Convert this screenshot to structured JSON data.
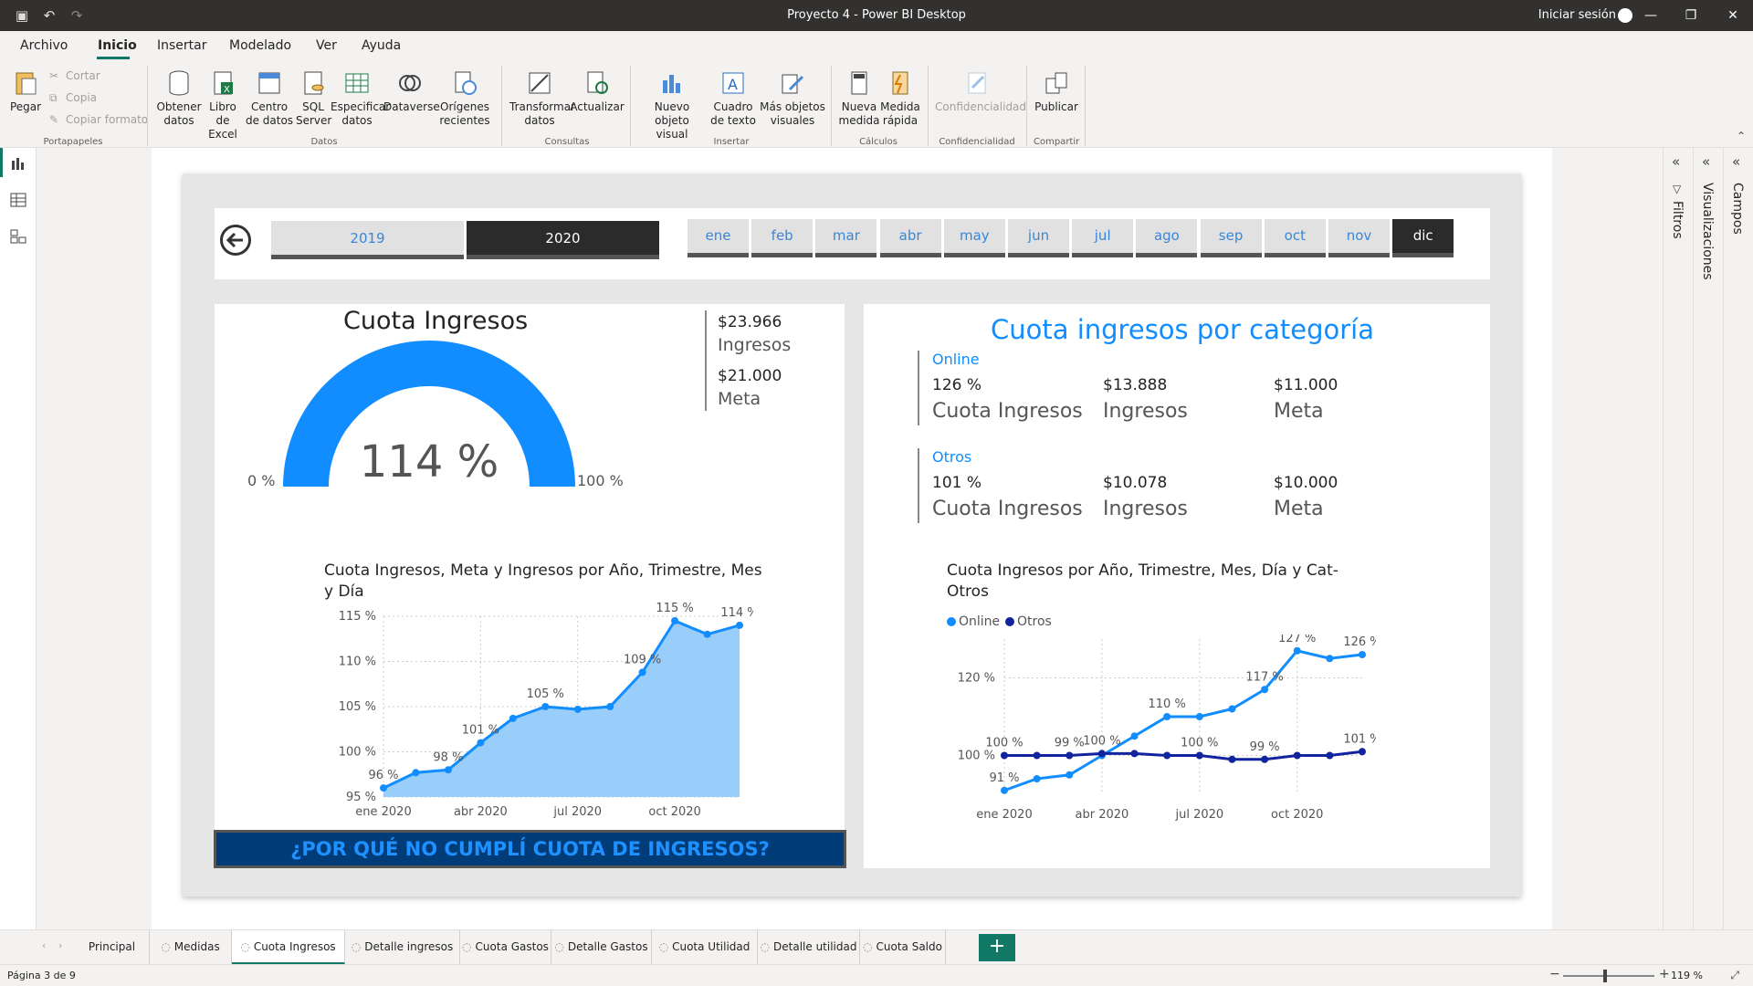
{
  "window": {
    "title": "Proyecto 4 - Power BI Desktop",
    "signin": "Iniciar sesión"
  },
  "menu": {
    "items": [
      "Archivo",
      "Inicio",
      "Insertar",
      "Modelado",
      "Ver",
      "Ayuda"
    ],
    "active": "Inicio"
  },
  "ribbon": {
    "paste": "Pegar",
    "cut": "Cortar",
    "copy": "Copia",
    "format_painter": "Copiar formato",
    "group_clipboard": "Portapapeles",
    "get_data": "Obtener datos",
    "excel": "Libro de Excel",
    "data_hub": "Centro de datos",
    "sql": "SQL Server",
    "enter_data": "Especificar datos",
    "dataverse": "Dataverse",
    "recent": "Orígenes recientes",
    "group_data": "Datos",
    "transform": "Transformar datos",
    "refresh": "Actualizar",
    "group_queries": "Consultas",
    "new_visual": "Nuevo objeto visual",
    "text_box": "Cuadro de texto",
    "more_visuals": "Más objetos visuales",
    "group_insert": "Insertar",
    "new_measure": "Nueva medida",
    "quick_measure": "Medida rápida",
    "group_calc": "Cálculos",
    "sensitivity": "Confidencialidad",
    "group_sensitivity": "Confidencialidad",
    "publish": "Publicar",
    "group_share": "Compartir"
  },
  "slicer": {
    "years": [
      "2019",
      "2020"
    ],
    "selected_year": "2020",
    "months": [
      "ene",
      "feb",
      "mar",
      "abr",
      "may",
      "jun",
      "jul",
      "ago",
      "sep",
      "oct",
      "nov",
      "dic"
    ],
    "selected_month": "dic"
  },
  "gauge": {
    "title": "Cuota Ingresos",
    "value": "114 %",
    "min": "0 %",
    "max": "100 %",
    "fill_fraction": 1.0
  },
  "kpis": {
    "ingresos_value": "$23.966",
    "ingresos_label": "Ingresos",
    "meta_value": "$21.000",
    "meta_label": "Meta"
  },
  "banner": "¿POR QUÉ NO CUMPLÍ CUOTA DE INGRESOS?",
  "categories": {
    "title": "Cuota ingresos por categoría",
    "online": {
      "name": "Online",
      "cuota": "126 %",
      "ingresos": "$13.888",
      "meta": "$11.000"
    },
    "otros": {
      "name": "Otros",
      "cuota": "101 %",
      "ingresos": "$10.078",
      "meta": "$10.000"
    },
    "lbl_cuota": "Cuota Ingresos",
    "lbl_ingresos": "Ingresos",
    "lbl_meta": "Meta"
  },
  "chart_data": [
    {
      "type": "area",
      "title": "Cuota Ingresos, Meta y Ingresos por Año, Trimestre, Mes y Día",
      "x": [
        "ene 2020",
        "feb 2020",
        "mar 2020",
        "abr 2020",
        "may 2020",
        "jun 2020",
        "jul 2020",
        "ago 2020",
        "sep 2020",
        "oct 2020",
        "nov 2020",
        "dic 2020"
      ],
      "xticks": [
        "ene 2020",
        "abr 2020",
        "jul 2020",
        "oct 2020"
      ],
      "yticks": [
        "95 %",
        "100 %",
        "105 %",
        "110 %",
        "115 %"
      ],
      "ylim": [
        95,
        115
      ],
      "values": [
        96,
        97.7,
        98,
        101,
        103.7,
        105,
        104.7,
        105,
        108.8,
        114.5,
        113,
        114
      ],
      "labels": [
        "96 %",
        "",
        "98 %",
        "101 %",
        "",
        "105 %",
        "",
        "",
        "109 %",
        "115 %",
        "",
        "114 %"
      ],
      "color": "#118dff",
      "fill": "#99cdfa"
    },
    {
      "type": "line",
      "title": "Cuota Ingresos por Año, Trimestre, Mes, Día y Cat-Otros",
      "x": [
        "ene 2020",
        "feb 2020",
        "mar 2020",
        "abr 2020",
        "may 2020",
        "jun 2020",
        "jul 2020",
        "ago 2020",
        "sep 2020",
        "oct 2020",
        "nov 2020",
        "dic 2020"
      ],
      "xticks": [
        "ene 2020",
        "abr 2020",
        "jul 2020",
        "oct 2020"
      ],
      "yticks": [
        "100 %",
        "120 %"
      ],
      "ylim": [
        90,
        130
      ],
      "series": [
        {
          "name": "Online",
          "color": "#118dff",
          "values": [
            91,
            94,
            95,
            100,
            105,
            110,
            110,
            112,
            117,
            127,
            125,
            126
          ],
          "labels": [
            "91 %",
            "",
            "",
            "",
            "",
            "110 %",
            "",
            "",
            "117 %",
            "127 %",
            "",
            "126 %"
          ]
        },
        {
          "name": "Otros",
          "color": "#12239e",
          "values": [
            100,
            100,
            100,
            100.5,
            100.5,
            100,
            100,
            99,
            99,
            100,
            100,
            101
          ],
          "labels": [
            "100 %",
            "",
            "99 %",
            "100 %",
            "",
            "",
            "100 %",
            "",
            "99 %",
            "",
            "",
            "101 %"
          ]
        }
      ]
    }
  ],
  "right_panes": [
    "Filtros",
    "Visualizaciones",
    "Campos"
  ],
  "tabs": {
    "items": [
      "Principal",
      "Medidas",
      "Cuota Ingresos",
      "Detalle ingresos",
      "Cuota Gastos",
      "Detalle Gastos",
      "Cuota Utilidad",
      "Detalle utilidad",
      "Cuota Saldo"
    ],
    "active": "Cuota Ingresos",
    "add": "+"
  },
  "status": {
    "page": "Página 3 de 9",
    "zoom": "119 %"
  }
}
